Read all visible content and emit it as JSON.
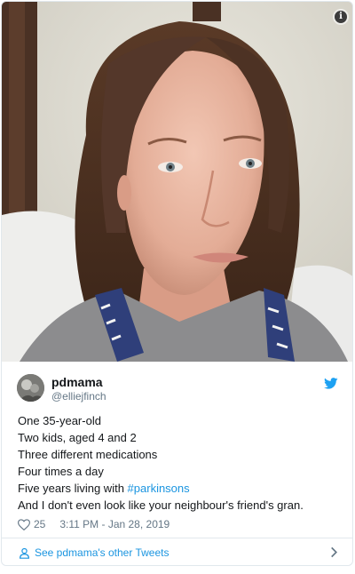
{
  "tweet": {
    "display_name": "pdmama",
    "handle": "@elliejfinch",
    "lines": [
      "One 35-year-old",
      "Two kids, aged 4 and 2",
      "Three different medications",
      "Four times a day"
    ],
    "line5_prefix": "Five years living with ",
    "hashtag": "#parkinsons",
    "line6": "And I don't even look like your neighbour's friend's gran.",
    "like_count": "25",
    "timestamp": "3:11 PM - Jan 28, 2019",
    "footer_link": "See pdmama's other Tweets"
  },
  "icons": {
    "info": "info-icon",
    "brand": "twitter-bird-icon",
    "like": "heart-icon",
    "profile": "person-icon",
    "more": "chevron-right-icon"
  },
  "colors": {
    "link": "#1b95e0",
    "text": "#14171a",
    "secondary": "#657786",
    "border": "#e1e8ed"
  }
}
